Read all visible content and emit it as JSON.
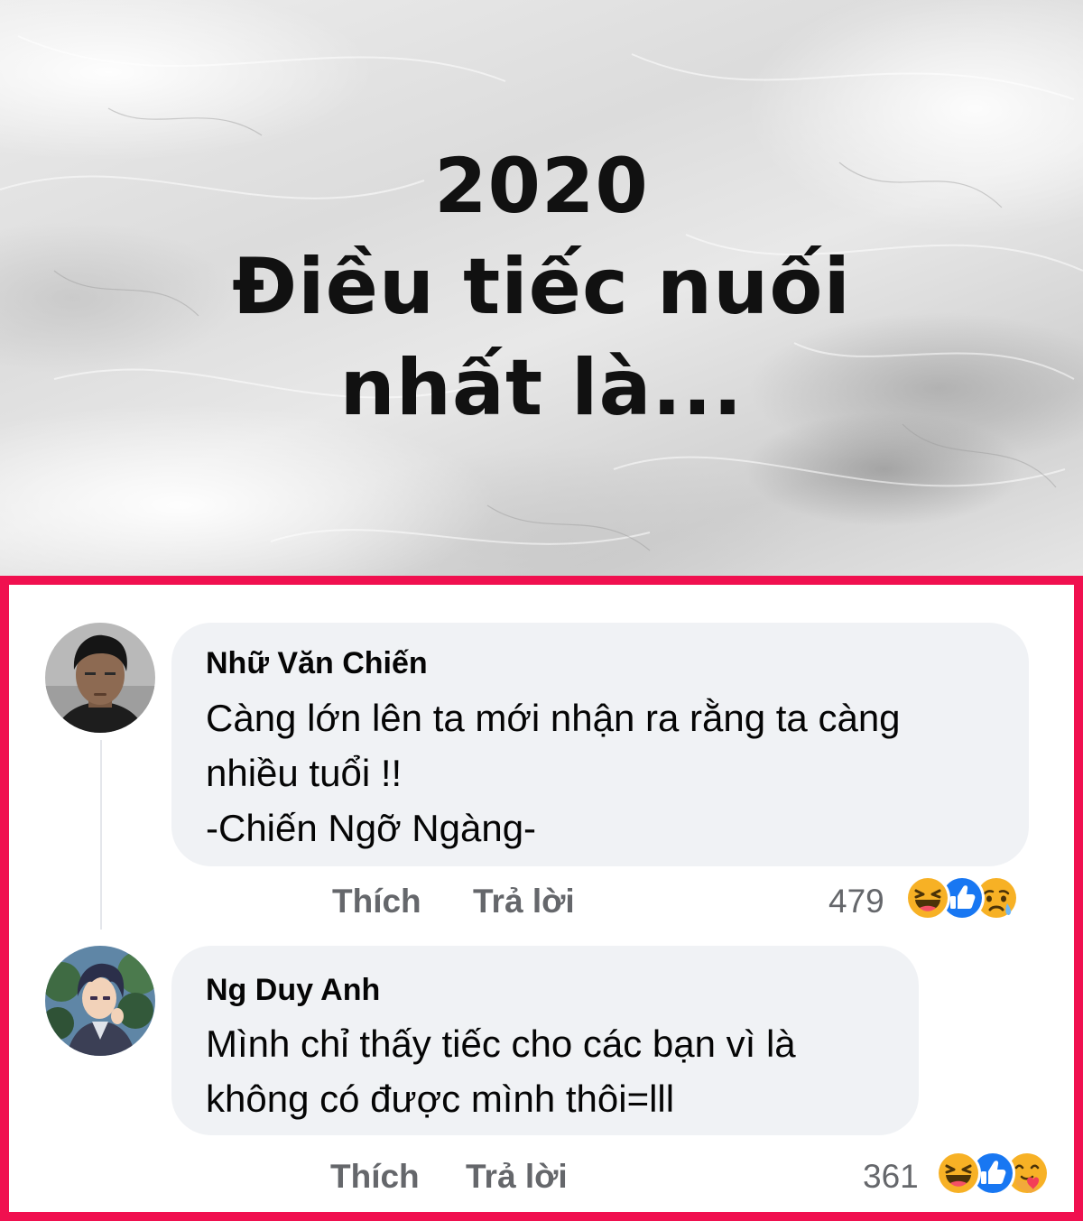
{
  "post_image": {
    "line1": "2020",
    "line2": "Điều tiếc nuối",
    "line3": "nhất là..."
  },
  "comments": [
    {
      "author": "Nhữ Văn Chiến",
      "text": "Càng lớn lên ta mới nhận ra rằng ta càng\nnhiều tuổi !!\n-Chiến Ngỡ Ngàng-",
      "like_label": "Thích",
      "reply_label": "Trả lời",
      "reaction_count": "479",
      "reactions": [
        "haha-icon",
        "like-icon",
        "sad-icon"
      ]
    },
    {
      "author": "Ng Duy Anh",
      "text": "Mình chỉ thấy tiếc cho các bạn vì là\nkhông có được mình thôi=lll",
      "like_label": "Thích",
      "reply_label": "Trả lời",
      "reaction_count": "361",
      "reactions": [
        "haha-icon",
        "like-icon",
        "care-icon"
      ]
    }
  ],
  "colors": {
    "frame": "#f0104f",
    "bubble": "#f0f2f5",
    "meta_text": "#65676b",
    "like_blue": "#1877f2",
    "emoji_yellow": "#f7b125"
  }
}
